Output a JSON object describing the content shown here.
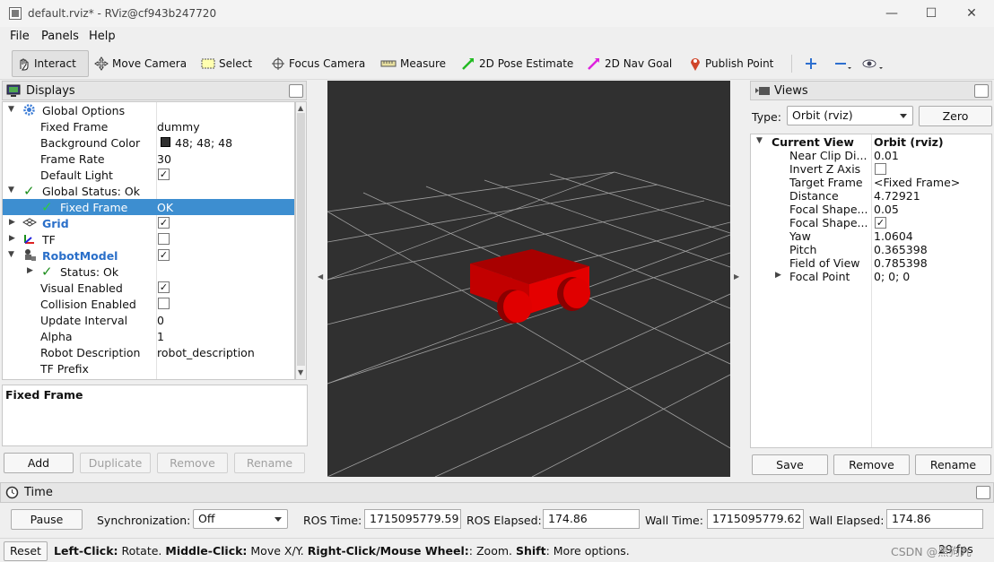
{
  "window": {
    "title": "default.rviz* - RViz@cf943b247720"
  },
  "menu": [
    "File",
    "Panels",
    "Help"
  ],
  "toolbar": {
    "interact": "Interact",
    "move_camera": "Move Camera",
    "select": "Select",
    "focus_camera": "Focus Camera",
    "measure": "Measure",
    "pose_estimate": "2D Pose Estimate",
    "nav_goal": "2D Nav Goal",
    "publish_point": "Publish Point"
  },
  "displays": {
    "title": "Displays",
    "rows": [
      {
        "label": "Global Options",
        "value": ""
      },
      {
        "label": "Fixed Frame",
        "value": "dummy"
      },
      {
        "label": "Background Color",
        "value": "48; 48; 48"
      },
      {
        "label": "Frame Rate",
        "value": "30"
      },
      {
        "label": "Default Light",
        "value": ""
      },
      {
        "label": "Global Status: Ok",
        "value": ""
      },
      {
        "label": "Fixed Frame",
        "value": "OK"
      },
      {
        "label": "Grid",
        "value": ""
      },
      {
        "label": "TF",
        "value": ""
      },
      {
        "label": "RobotModel",
        "value": ""
      },
      {
        "label": "Status: Ok",
        "value": ""
      },
      {
        "label": "Visual Enabled",
        "value": ""
      },
      {
        "label": "Collision Enabled",
        "value": ""
      },
      {
        "label": "Update Interval",
        "value": "0"
      },
      {
        "label": "Alpha",
        "value": "1"
      },
      {
        "label": "Robot Description",
        "value": "robot_description"
      },
      {
        "label": "TF Prefix",
        "value": ""
      }
    ],
    "description_title": "Fixed Frame",
    "buttons": {
      "add": "Add",
      "duplicate": "Duplicate",
      "remove": "Remove",
      "rename": "Rename"
    }
  },
  "views": {
    "title": "Views",
    "type_label": "Type:",
    "type_value": "Orbit (rviz)",
    "zero": "Zero",
    "rows": [
      {
        "label": "Current View",
        "value": "Orbit (rviz)"
      },
      {
        "label": "Near Clip Di...",
        "value": "0.01"
      },
      {
        "label": "Invert Z Axis",
        "value": ""
      },
      {
        "label": "Target Frame",
        "value": "<Fixed Frame>"
      },
      {
        "label": "Distance",
        "value": "4.72921"
      },
      {
        "label": "Focal Shape...",
        "value": "0.05"
      },
      {
        "label": "Focal Shape...",
        "value": ""
      },
      {
        "label": "Yaw",
        "value": "1.0604"
      },
      {
        "label": "Pitch",
        "value": "0.365398"
      },
      {
        "label": "Field of View",
        "value": "0.785398"
      },
      {
        "label": "Focal Point",
        "value": "0; 0; 0"
      }
    ],
    "buttons": {
      "save": "Save",
      "remove": "Remove",
      "rename": "Rename"
    }
  },
  "time": {
    "title": "Time",
    "pause": "Pause",
    "sync_label": "Synchronization:",
    "sync_value": "Off",
    "ros_time_label": "ROS Time:",
    "ros_time": "1715095779.59",
    "ros_elapsed_label": "ROS Elapsed:",
    "ros_elapsed": "174.86",
    "wall_time_label": "Wall Time:",
    "wall_time": "1715095779.62",
    "wall_elapsed_label": "Wall Elapsed:",
    "wall_elapsed": "174.86"
  },
  "status": {
    "reset": "Reset",
    "b1": "Left-Click:",
    "t1": " Rotate. ",
    "b2": "Middle-Click:",
    "t2": " Move X/Y. ",
    "b3": "Right-Click/Mouse Wheel:",
    "t3": ": Zoom. ",
    "b4": "Shift",
    "t4": ": More options.",
    "fps": "29 fps",
    "watermark": "CSDN @黑狗九"
  },
  "colors": {
    "background": "#303030",
    "selection": "#3d8ed0",
    "robot": "#cc0000"
  }
}
